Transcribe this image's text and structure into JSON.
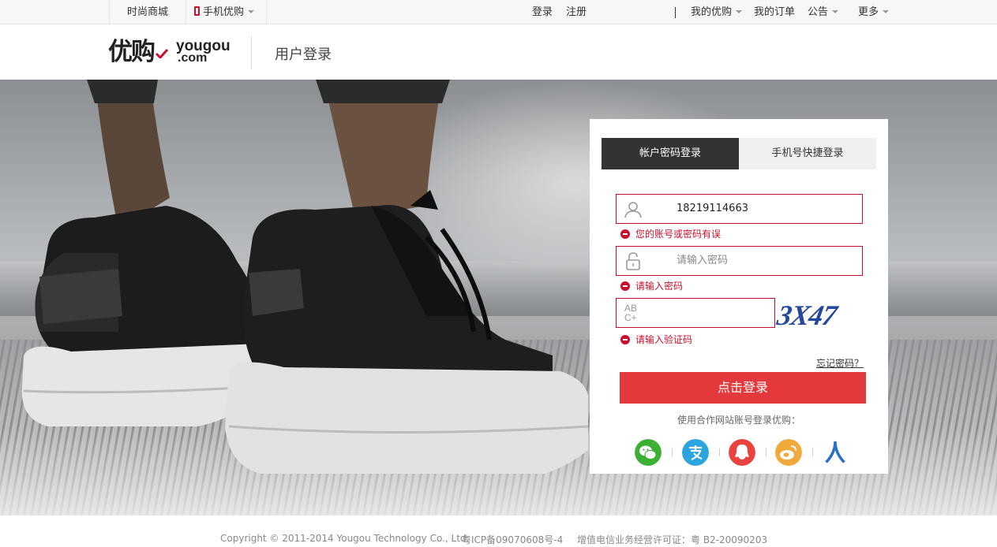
{
  "topbar": {
    "shop": "时尚商城",
    "mobile": "手机优购",
    "login": "登录",
    "register": "注册",
    "my_yougou": "我的优购",
    "my_orders": "我的订单",
    "notice": "公告",
    "more": "更多"
  },
  "header": {
    "logo_cn": "优购",
    "logo_en": "yougou",
    "logo_com": ".com",
    "title": "用户登录"
  },
  "login_panel": {
    "tabs": [
      "帐户密码登录",
      "手机号快捷登录"
    ],
    "active_tab": 0,
    "account_value": "18219114663",
    "account_error": "您的账号或密码有误",
    "password_placeholder": "请输入密码",
    "password_error": "请输入密码",
    "captcha_label": "AB\nC+",
    "captcha_image_text": "3X47",
    "captcha_error": "请输入验证码",
    "forgot": "忘记密码？",
    "submit": "点击登录",
    "partner_text": "使用合作网站账号登录优购：",
    "partners": [
      "wechat-icon",
      "alipay-icon",
      "qq-icon",
      "weibo-icon",
      "renren-icon"
    ]
  },
  "footer": {
    "copyright": "Copyright © 2011-2014 Yougou Technology Co., Ltd.",
    "icp": "粤ICP备09070608号-4",
    "license": "增值电信业务经营许可证：粤 B2-20090203"
  },
  "colors": {
    "accent_red": "#c8102e",
    "button_red": "#e3393c",
    "tab_dark": "#333333",
    "wechat": "#3cb034",
    "alipay": "#2aa5e0",
    "qq": "#e8433e",
    "weibo": "#f2a93b",
    "renren": "#2a6fc4"
  }
}
